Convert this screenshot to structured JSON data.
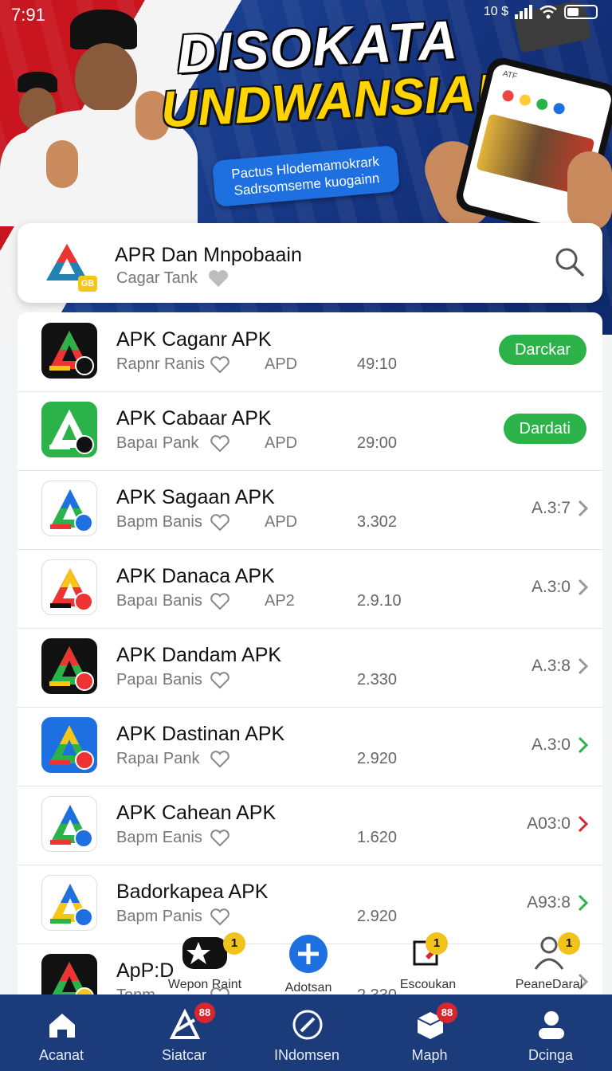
{
  "status_bar": {
    "time": "7:91",
    "network": "10 $"
  },
  "banner": {
    "headline_1": "DISOKATA",
    "headline_2": "UNDWANSIA!",
    "promo_line_1": "Pactus Hlodemamokrark",
    "promo_line_2": "Sadrsomseme kuogainn",
    "phone_header": "ATF"
  },
  "header": {
    "title": "APR Dan Mnpobaain",
    "subtitle": "Cagar Tank",
    "logo_badge": "GB"
  },
  "apps": [
    {
      "title": "APK Caganr APK",
      "subtitle": "Rapnr Ranis",
      "tag": "APD",
      "number": "49:10",
      "action": "Darckar",
      "action_type": "button"
    },
    {
      "title": "APK Cabaar APK",
      "subtitle": "Bapaı Pank",
      "tag": "APD",
      "number": "29:00",
      "action": "Dardati",
      "action_type": "button"
    },
    {
      "title": "APK Sagaan APK",
      "subtitle": "Bapm Banis",
      "tag": "APD",
      "number": "3.302",
      "action": "A.3:7",
      "action_type": "link",
      "chevron_color": "#999999"
    },
    {
      "title": "APK Danaca APK",
      "subtitle": "Bapaı Banis",
      "tag": "AP2",
      "number": "2.9.10",
      "action": "A.3:0",
      "action_type": "link",
      "chevron_color": "#999999"
    },
    {
      "title": "APK Dandam APK",
      "subtitle": "Papaı Banis",
      "tag": "",
      "number": "2.330",
      "action": "A.3:8",
      "action_type": "link",
      "chevron_color": "#999999"
    },
    {
      "title": "APK Dastinan APK",
      "subtitle": "Rapaı Pank",
      "tag": "",
      "number": "2.920",
      "action": "A.3:0",
      "action_type": "link",
      "chevron_color": "#2bb34a"
    },
    {
      "title": "APK Cahean APK",
      "subtitle": "Bapm Eanis",
      "tag": "",
      "number": "1.620",
      "action": "A03:0",
      "action_type": "link",
      "chevron_color": "#d8262e"
    },
    {
      "title": "Badorkapea APK",
      "subtitle": "Bapm Panis",
      "tag": "",
      "number": "2.920",
      "action": "A93:8",
      "action_type": "link",
      "chevron_color": "#2bb34a"
    },
    {
      "title": "ApP:D",
      "subtitle": "Tonm",
      "tag": "",
      "number": "2.330",
      "action": "",
      "action_type": "link",
      "chevron_color": "#999999"
    }
  ],
  "mini_toolbar": [
    {
      "label": "Wepon Raint",
      "icon": "star-icon",
      "badge": "1"
    },
    {
      "label": "Adotsan",
      "icon": "plus-icon",
      "badge": ""
    },
    {
      "label": "Escoukan",
      "icon": "edit-icon",
      "badge": "1"
    },
    {
      "label": "PeaneDaral",
      "icon": "profile-icon",
      "badge": "1"
    }
  ],
  "bottom_nav": [
    {
      "label": "Acanat",
      "icon": "home-icon",
      "badge": ""
    },
    {
      "label": "Siatcar",
      "icon": "apps-icon",
      "badge": "88"
    },
    {
      "label": "INdomsen",
      "icon": "compass-icon",
      "badge": ""
    },
    {
      "label": "Maph",
      "icon": "box-icon",
      "badge": "88"
    },
    {
      "label": "Dcinga",
      "icon": "user-icon",
      "badge": ""
    }
  ],
  "colors": {
    "accent_green": "#2bb34a",
    "nav_blue": "#1b3b7a",
    "banner_red": "#c8151f",
    "headline_yellow": "#ffd400"
  }
}
